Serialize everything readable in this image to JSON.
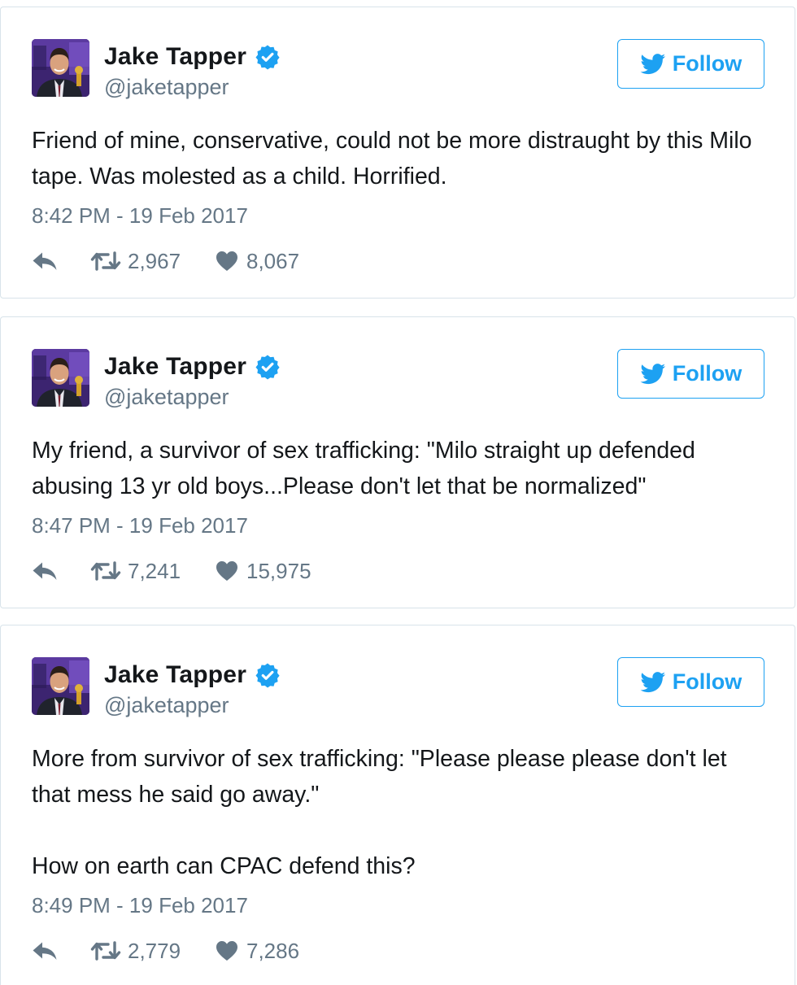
{
  "accent_color": "#1da1f2",
  "tweets": [
    {
      "author_name": "Jake Tapper",
      "handle": "@jaketapper",
      "follow_label": "Follow",
      "paragraphs": [
        "Friend of mine, conservative, could not be more distraught by this Milo tape. Was molested as a child. Horrified."
      ],
      "timestamp": "8:42 PM - 19 Feb 2017",
      "retweets": "2,967",
      "likes": "8,067"
    },
    {
      "author_name": "Jake Tapper",
      "handle": "@jaketapper",
      "follow_label": "Follow",
      "paragraphs": [
        "My friend, a survivor of sex trafficking: \"Milo straight up defended abusing 13 yr old boys...Please don't let that be normalized\""
      ],
      "timestamp": "8:47 PM - 19 Feb 2017",
      "retweets": "7,241",
      "likes": "15,975"
    },
    {
      "author_name": "Jake Tapper",
      "handle": "@jaketapper",
      "follow_label": "Follow",
      "paragraphs": [
        "More from survivor of sex trafficking: \"Please please please don't let that mess he said go away.\"",
        "How on earth can CPAC defend this?"
      ],
      "timestamp": "8:49 PM - 19 Feb 2017",
      "retweets": "2,779",
      "likes": "7,286"
    }
  ],
  "icons": {
    "avatar": "avatar-photo",
    "verified": "verified-badge-icon",
    "follow": "twitter-bird-icon",
    "reply": "reply-icon",
    "retweet": "retweet-icon",
    "like": "heart-icon"
  }
}
